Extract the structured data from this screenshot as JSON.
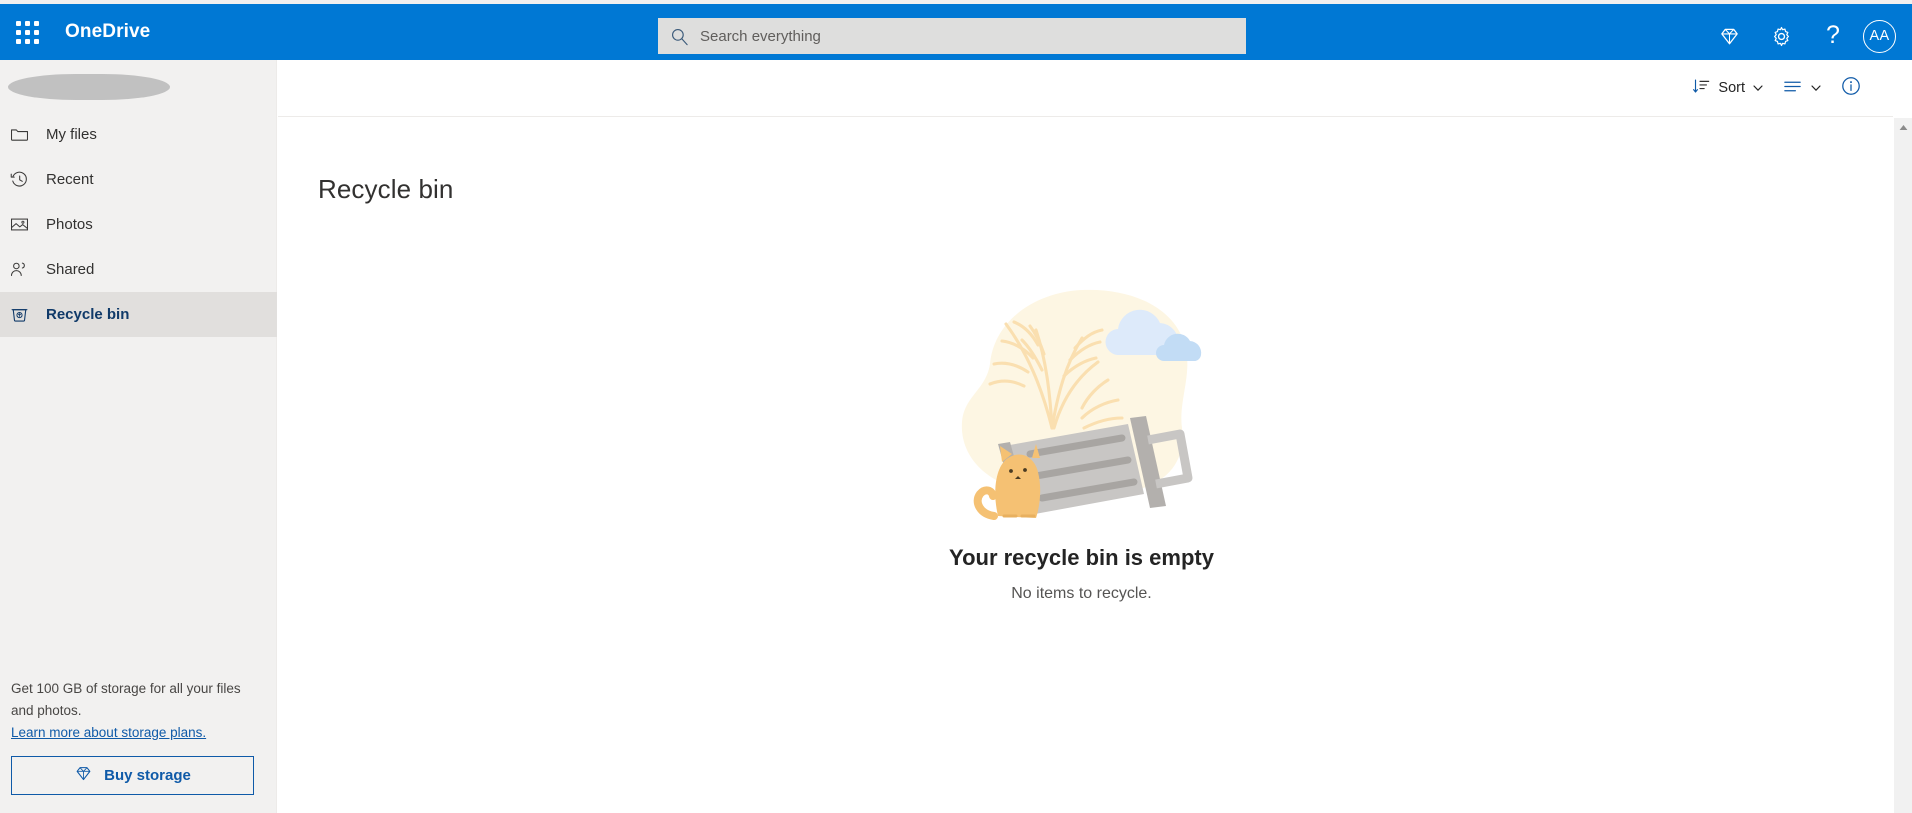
{
  "header": {
    "waffle_label": "app-launcher",
    "brand": "OneDrive",
    "search": {
      "placeholder": "Search everything",
      "value": ""
    },
    "actions": {
      "premium_label": "Premium",
      "settings_label": "Settings",
      "help_label": "?",
      "avatar_initials": "AA"
    }
  },
  "sidebar": {
    "account_redacted": "",
    "items": [
      {
        "label": "My files",
        "icon": "folder-icon",
        "selected": false
      },
      {
        "label": "Recent",
        "icon": "clock-icon",
        "selected": false
      },
      {
        "label": "Photos",
        "icon": "photo-icon",
        "selected": false
      },
      {
        "label": "Shared",
        "icon": "people-icon",
        "selected": false
      },
      {
        "label": "Recycle bin",
        "icon": "recycle-bin-icon",
        "selected": true
      }
    ],
    "storage": {
      "promo_text": "Get 100 GB of storage for all your files and photos.",
      "link_text": "Learn more about storage plans.",
      "buy_button": "Buy storage"
    }
  },
  "toolbar": {
    "sort_label": "Sort",
    "view_label": "View options",
    "info_label": "Details"
  },
  "main": {
    "page_title": "Recycle bin",
    "empty_state": {
      "title": "Your recycle bin is empty",
      "subtitle": "No items to recycle."
    }
  },
  "colors": {
    "brand_blue": "#0078d4",
    "sidebar_bg": "#f2f1f0",
    "selected_row": "#e1dfdd",
    "selected_text": "#103a69",
    "link_blue": "#0f5aa8",
    "illustration_cream": "#fdf6e3",
    "illustration_frond": "#fadfb0",
    "illustration_cloud_light": "#ddeafa",
    "illustration_cloud_dark": "#c2dcf5",
    "illustration_bin": "#c8c6c4",
    "illustration_cat": "#f5c173"
  }
}
